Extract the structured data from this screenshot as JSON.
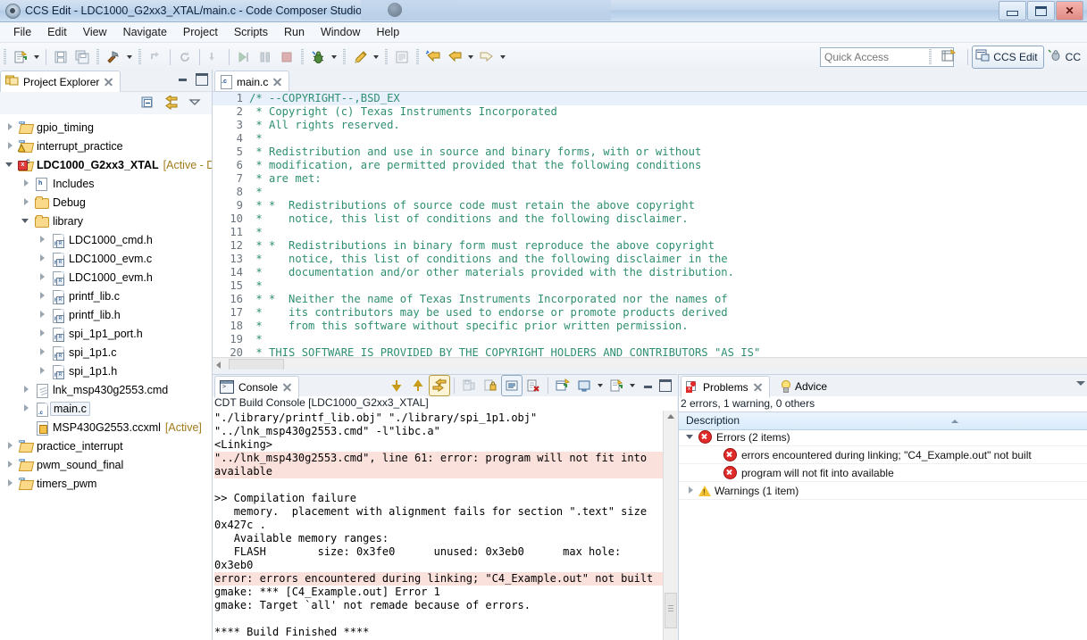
{
  "window": {
    "title": "CCS Edit - LDC1000_G2xx3_XTAL/main.c - Code Composer Studio",
    "minimize_label": "",
    "maximize_label": "",
    "close_label": "✕"
  },
  "menubar": {
    "items": [
      "File",
      "Edit",
      "View",
      "Navigate",
      "Project",
      "Scripts",
      "Run",
      "Window",
      "Help"
    ]
  },
  "toolbar": {
    "quick_access_placeholder": "Quick Access",
    "perspective_active": "CCS Edit",
    "perspective_other": "CC"
  },
  "project_explorer": {
    "tab_label": "Project Explorer",
    "tree": [
      {
        "label": "gpio_timing",
        "indent": 0,
        "twisty": "closed",
        "icon": "ccs-project-icon",
        "suffix": ""
      },
      {
        "label": "interrupt_practice",
        "indent": 0,
        "twisty": "closed",
        "icon": "ccs-project-warning-icon",
        "suffix": ""
      },
      {
        "label": "LDC1000_G2xx3_XTAL",
        "indent": 0,
        "twisty": "open",
        "icon": "ccs-project-error-icon",
        "suffix": "[Active - D",
        "bold": true
      },
      {
        "label": "Includes",
        "indent": 1,
        "twisty": "closed",
        "icon": "includes-icon",
        "suffix": ""
      },
      {
        "label": "Debug",
        "indent": 1,
        "twisty": "closed",
        "icon": "folder-icon",
        "suffix": ""
      },
      {
        "label": "library",
        "indent": 1,
        "twisty": "open",
        "icon": "folder-icon",
        "suffix": ""
      },
      {
        "label": "LDC1000_cmd.h",
        "indent": 2,
        "twisty": "closed",
        "icon": "header-file-icon",
        "suffix": ""
      },
      {
        "label": "LDC1000_evm.c",
        "indent": 2,
        "twisty": "closed",
        "icon": "header-file-icon",
        "suffix": ""
      },
      {
        "label": "LDC1000_evm.h",
        "indent": 2,
        "twisty": "closed",
        "icon": "header-file-icon",
        "suffix": ""
      },
      {
        "label": "printf_lib.c",
        "indent": 2,
        "twisty": "closed",
        "icon": "header-file-icon",
        "suffix": ""
      },
      {
        "label": "printf_lib.h",
        "indent": 2,
        "twisty": "closed",
        "icon": "header-file-icon",
        "suffix": ""
      },
      {
        "label": "spi_1p1_port.h",
        "indent": 2,
        "twisty": "closed",
        "icon": "header-file-icon",
        "suffix": ""
      },
      {
        "label": "spi_1p1.c",
        "indent": 2,
        "twisty": "closed",
        "icon": "header-file-icon",
        "suffix": ""
      },
      {
        "label": "spi_1p1.h",
        "indent": 2,
        "twisty": "closed",
        "icon": "header-file-icon",
        "suffix": ""
      },
      {
        "label": "lnk_msp430g2553.cmd",
        "indent": 1,
        "twisty": "closed",
        "icon": "linker-command-file-icon",
        "suffix": ""
      },
      {
        "label": "main.c",
        "indent": 1,
        "twisty": "closed",
        "icon": "c-file-icon",
        "suffix": "",
        "selected": true
      },
      {
        "label": "MSP430G2553.ccxml",
        "indent": 1,
        "twisty": "none",
        "icon": "ccxml-file-icon",
        "suffix": "[Active]"
      },
      {
        "label": "practice_interrupt",
        "indent": 0,
        "twisty": "closed",
        "icon": "ccs-project-icon",
        "suffix": ""
      },
      {
        "label": "pwm_sound_final",
        "indent": 0,
        "twisty": "closed",
        "icon": "ccs-project-icon",
        "suffix": ""
      },
      {
        "label": "timers_pwm",
        "indent": 0,
        "twisty": "closed",
        "icon": "ccs-project-icon",
        "suffix": ""
      }
    ]
  },
  "editor": {
    "tab_label": "main.c",
    "lines": [
      {
        "n": "1",
        "text": "/* --COPYRIGHT--,BSD_EX",
        "highlight": true
      },
      {
        "n": "2",
        "text": " * Copyright (c) Texas Instruments Incorporated"
      },
      {
        "n": "3",
        "text": " * All rights reserved."
      },
      {
        "n": "4",
        "text": " *"
      },
      {
        "n": "5",
        "text": " * Redistribution and use in source and binary forms, with or without"
      },
      {
        "n": "6",
        "text": " * modification, are permitted provided that the following conditions"
      },
      {
        "n": "7",
        "text": " * are met:"
      },
      {
        "n": "8",
        "text": " *"
      },
      {
        "n": "9",
        "text": " * *  Redistributions of source code must retain the above copyright"
      },
      {
        "n": "10",
        "text": " *    notice, this list of conditions and the following disclaimer."
      },
      {
        "n": "11",
        "text": " *"
      },
      {
        "n": "12",
        "text": " * *  Redistributions in binary form must reproduce the above copyright"
      },
      {
        "n": "13",
        "text": " *    notice, this list of conditions and the following disclaimer in the"
      },
      {
        "n": "14",
        "text": " *    documentation and/or other materials provided with the distribution."
      },
      {
        "n": "15",
        "text": " *"
      },
      {
        "n": "16",
        "text": " * *  Neither the name of Texas Instruments Incorporated nor the names of"
      },
      {
        "n": "17",
        "text": " *    its contributors may be used to endorse or promote products derived"
      },
      {
        "n": "18",
        "text": " *    from this software without specific prior written permission."
      },
      {
        "n": "19",
        "text": " *"
      },
      {
        "n": "20",
        "text": " * THIS SOFTWARE IS PROVIDED BY THE COPYRIGHT HOLDERS AND CONTRIBUTORS \"AS IS\""
      }
    ]
  },
  "console": {
    "tab_label": "Console",
    "subtitle": "CDT Build Console [LDC1000_G2xx3_XTAL]",
    "lines": [
      {
        "text": "\"./library/printf_lib.obj\" \"./library/spi_1p1.obj\""
      },
      {
        "text": "\"../lnk_msp430g2553.cmd\" -l\"libc.a\""
      },
      {
        "text": "<Linking>"
      },
      {
        "text": "\"../lnk_msp430g2553.cmd\", line 61: error: program will not fit into\navailable",
        "error": true
      },
      {
        "text": ""
      },
      {
        "text": ">> Compilation failure"
      },
      {
        "text": "   memory.  placement with alignment fails for section \".text\" size\n0x427c ."
      },
      {
        "text": "   Available memory ranges:"
      },
      {
        "text": "   FLASH        size: 0x3fe0      unused: 0x3eb0      max hole:\n0x3eb0"
      },
      {
        "text": "error: errors encountered during linking; \"C4_Example.out\" not built",
        "error": true
      },
      {
        "text": "gmake: *** [C4_Example.out] Error 1"
      },
      {
        "text": "gmake: Target `all' not remade because of errors."
      },
      {
        "text": ""
      },
      {
        "text": "**** Build Finished ****"
      }
    ]
  },
  "problems": {
    "tab_label": "Problems",
    "advice_tab_label": "Advice",
    "summary": "2 errors, 1 warning, 0 others",
    "column_header": "Description",
    "rows": [
      {
        "label": "Errors (2 items)",
        "indent": 0,
        "twisty": "open",
        "icon": "error-icon"
      },
      {
        "label": "errors encountered during linking; \"C4_Example.out\" not built",
        "indent": 1,
        "twisty": "none",
        "icon": "error-icon"
      },
      {
        "label": "program will not fit into available",
        "indent": 1,
        "twisty": "none",
        "icon": "error-icon"
      },
      {
        "label": "Warnings (1 item)",
        "indent": 0,
        "twisty": "closed",
        "icon": "warning-icon"
      }
    ]
  },
  "colors": {
    "comment_green": "#2f8f72",
    "error_bg": "#fbe1dc",
    "error_red": "#e02b2b",
    "warning_yellow": "#f2c133",
    "active_gold": "#a07b1a",
    "selection_blue": "#e8f1fb"
  }
}
